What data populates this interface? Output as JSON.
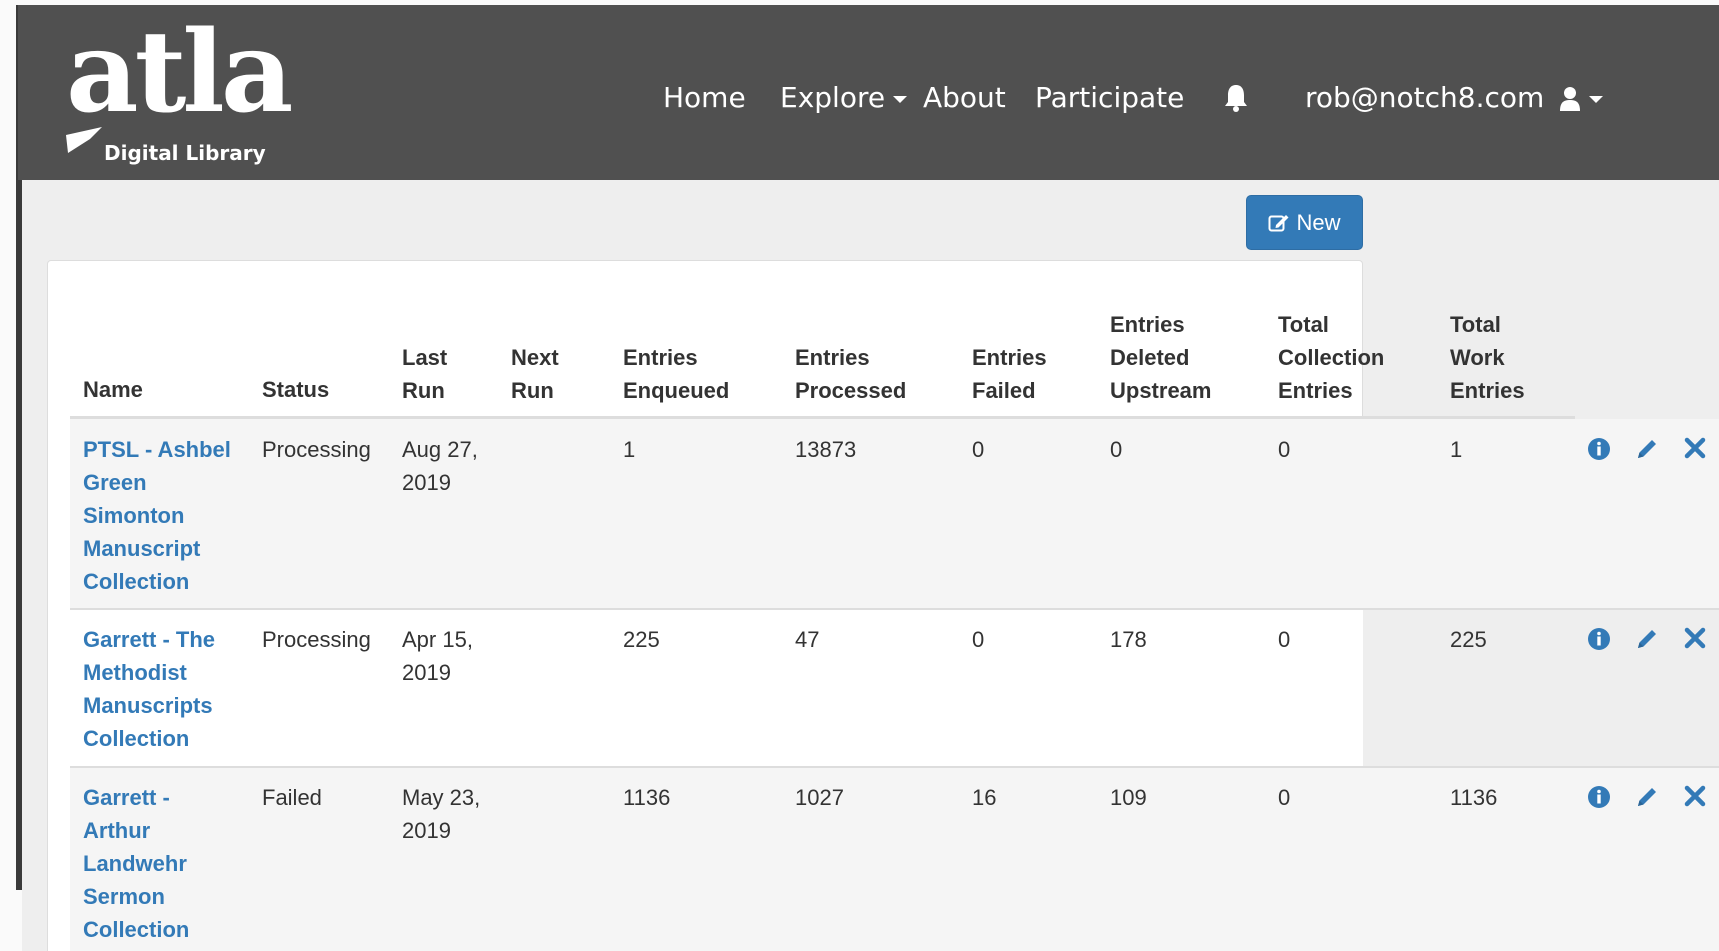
{
  "navbar": {
    "logo_text": "atla",
    "logo_subtitle": "Digital Library",
    "links": {
      "home": "Home",
      "explore": "Explore",
      "about": "About",
      "participate": "Participate"
    },
    "user_email": "rob@notch8.com"
  },
  "toolbar": {
    "new_label": "New"
  },
  "table": {
    "headers": {
      "name": "Name",
      "status": "Status",
      "last_run": [
        "Last",
        "Run"
      ],
      "next_run": [
        "Next",
        "Run"
      ],
      "enqueued": [
        "Entries",
        "Enqueued"
      ],
      "processed": [
        "Entries",
        "Processed"
      ],
      "failed": [
        "Entries",
        "Failed"
      ],
      "deleted": [
        "Entries",
        "Deleted",
        "Upstream"
      ],
      "total_collection": [
        "Total",
        "Collection",
        "Entries"
      ],
      "total_work": [
        "Total",
        "Work",
        "Entries"
      ]
    },
    "rows": [
      {
        "name": [
          "PTSL - Ashbel",
          "Green",
          "Simonton",
          "Manuscript",
          "Collection"
        ],
        "status": "Processing",
        "last_run": [
          "Aug 27,",
          "2019"
        ],
        "next_run": "",
        "enqueued": "1",
        "processed": "13873",
        "failed": "0",
        "deleted": "0",
        "total_collection": "0",
        "total_work": "1"
      },
      {
        "name": [
          "Garrett - The",
          "Methodist",
          "Manuscripts",
          "Collection"
        ],
        "status": "Processing",
        "last_run": [
          "Apr 15,",
          "2019"
        ],
        "next_run": "",
        "enqueued": "225",
        "processed": "47",
        "failed": "0",
        "deleted": "178",
        "total_collection": "0",
        "total_work": "225"
      },
      {
        "name": [
          "Garrett -",
          "Arthur",
          "Landwehr",
          "Sermon",
          "Collection"
        ],
        "status": "Failed",
        "last_run": [
          "May 23,",
          "2019"
        ],
        "next_run": "",
        "enqueued": "1136",
        "processed": "1027",
        "failed": "16",
        "deleted": "109",
        "total_collection": "0",
        "total_work": "1136"
      }
    ]
  },
  "colors": {
    "navbar_bg": "#505050",
    "link": "#337ab7",
    "primary_button": "#337ab7"
  },
  "icons": [
    "edit-icon",
    "bell-icon",
    "user-icon",
    "info-icon",
    "pencil-icon",
    "delete-x-icon"
  ]
}
